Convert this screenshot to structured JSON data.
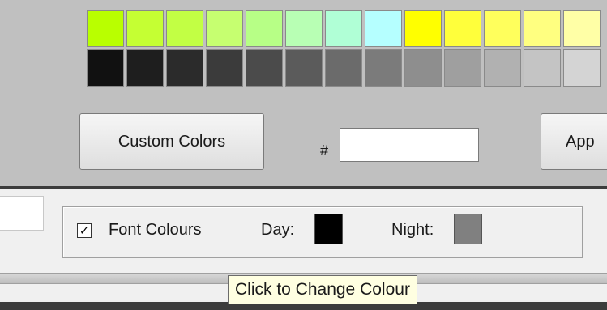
{
  "palette": {
    "row_top": [
      "#b9ff00",
      "#c5ff33",
      "#c2ff44",
      "#c6ff70",
      "#b7ff86",
      "#b8ffb4",
      "#b0ffd6",
      "#b5ffff",
      "#ffff00",
      "#ffff3b",
      "#ffff5c",
      "#ffff80",
      "#ffffa6"
    ],
    "row_bottom": [
      "#111111",
      "#1e1e1e",
      "#2b2b2b",
      "#3b3b3b",
      "#4b4b4b",
      "#5b5b5b",
      "#6b6b6b",
      "#7b7b7b",
      "#8e8e8e",
      "#9f9f9f",
      "#b1b1b1",
      "#c4c4c4",
      "#d4d4d4"
    ]
  },
  "buttons": {
    "custom_colors": "Custom Colors",
    "apply": "App"
  },
  "hex": {
    "prefix": "#",
    "value": ""
  },
  "font_colours": {
    "checked": true,
    "check_mark": "✓",
    "label": "Font Colours",
    "day_label": "Day:",
    "day_color": "#000000",
    "night_label": "Night:",
    "night_color": "#808080"
  },
  "tooltip": {
    "text": "Click to Change Colour"
  }
}
